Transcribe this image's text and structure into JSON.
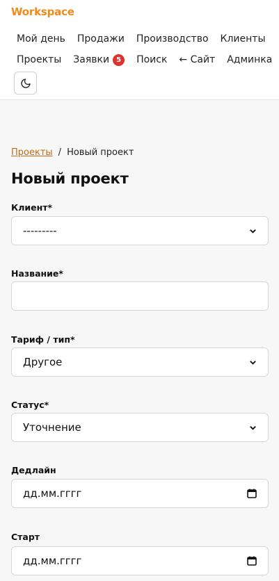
{
  "header": {
    "brand": "Workspace",
    "nav_row1": [
      "Мой день",
      "Продажи",
      "Производство",
      "Клиенты"
    ],
    "nav_row2": {
      "projects": "Проекты",
      "requests": "Заявки",
      "requests_badge": "5",
      "search": "Поиск",
      "site": "← Сайт",
      "admin": "Админка"
    },
    "theme_toggle_icon": "moon-icon"
  },
  "breadcrumb": {
    "parent": "Проекты",
    "separator": "/",
    "current": "Новый проект"
  },
  "page_title": "Новый проект",
  "form": {
    "client": {
      "label": "Клиент*",
      "value": "---------"
    },
    "name": {
      "label": "Название*",
      "value": ""
    },
    "tariff": {
      "label": "Тариф / тип*",
      "value": "Другое"
    },
    "status": {
      "label": "Статус*",
      "value": "Уточнение"
    },
    "deadline": {
      "label": "Дедлайн",
      "placeholder": "дд.мм.гггг"
    },
    "start": {
      "label": "Старт",
      "placeholder": "дд.мм.гггг"
    }
  },
  "colors": {
    "brand": "#f28a1a",
    "link": "#c56a12",
    "badge": "#e03131"
  }
}
